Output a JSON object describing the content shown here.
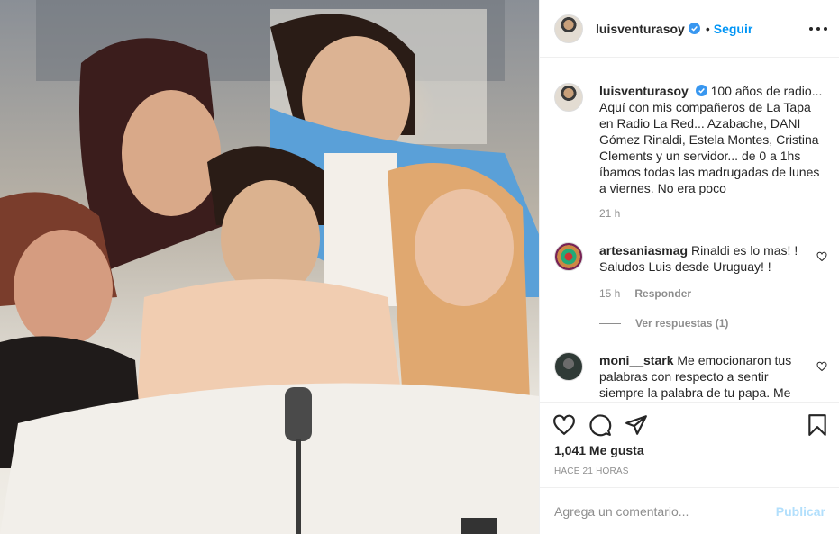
{
  "photo": {
    "alt_icon": "group-photo"
  },
  "header": {
    "username": "luisventurasoy",
    "follow_label": "Seguir",
    "separator": "•"
  },
  "caption": {
    "username": "luisventurasoy",
    "text": "100 años de radio... Aquí con mis compañeros de La Tapa en Radio La Red... Azabache, DANI Gómez Rinaldi, Estela Montes, Cristina Clements y un servidor... de 0 a 1hs íbamos todas las madrugadas de lunes a viernes. No era poco",
    "time": "21 h"
  },
  "comments": [
    {
      "username": "artesaniasmag",
      "text": "Rinaldi es lo mas! ! Saludos Luis desde Uruguay! !",
      "time": "15 h",
      "reply_label": "Responder",
      "view_replies": "Ver respuestas (1)"
    },
    {
      "username": "moni__stark",
      "text": "Me emocionaron tus palabras con respecto a sentir siempre la palabra de tu papa. Me"
    }
  ],
  "actions": {
    "likes": "1,041 Me gusta",
    "posted": "Hace 21 horas"
  },
  "comment_box": {
    "placeholder": "Agrega un comentario...",
    "post_label": "Publicar"
  },
  "colors": {
    "accent": "#0095f6",
    "text": "#262626",
    "muted": "#8e8e8e",
    "post_disabled": "#b2dffc"
  }
}
